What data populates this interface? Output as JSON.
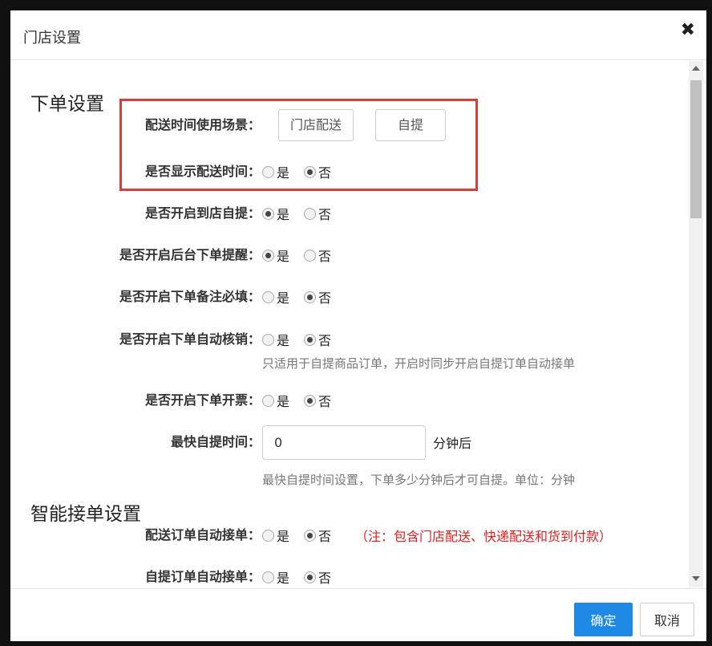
{
  "dialog": {
    "title": "门店设置",
    "close_icon": "close-icon"
  },
  "section_order": {
    "title": "下单设置",
    "delivery_scene": {
      "label": "配送时间使用场景：",
      "options": [
        "门店配送",
        "自提"
      ]
    },
    "show_delivery_time": {
      "label": "是否显示配送时间：",
      "yes": "是",
      "no": "否",
      "selected": "no"
    },
    "enable_store_pickup": {
      "label": "是否开启到店自提：",
      "yes": "是",
      "no": "否",
      "selected": "yes"
    },
    "enable_backend_alert": {
      "label": "是否开启后台下单提醒：",
      "yes": "是",
      "no": "否",
      "selected": "yes"
    },
    "require_remark": {
      "label": "是否开启下单备注必填：",
      "yes": "是",
      "no": "否",
      "selected": "no"
    },
    "auto_verify": {
      "label": "是否开启下单自动核销：",
      "yes": "是",
      "no": "否",
      "selected": "no",
      "hint": "只适用于自提商品订单，开启时同步开启自提订单自动接单"
    },
    "invoice": {
      "label": "是否开启下单开票：",
      "yes": "是",
      "no": "否",
      "selected": "no"
    },
    "earliest_pickup": {
      "label": "最快自提时间：",
      "value": "0",
      "unit": "分钟后",
      "hint": "最快自提时间设置，下单多少分钟后才可自提。单位：分钟"
    }
  },
  "section_auto_accept": {
    "title": "智能接单设置",
    "delivery_auto_accept": {
      "label": "配送订单自动接单：",
      "yes": "是",
      "no": "否",
      "selected": "no",
      "note": "（注：包含门店配送、快递配送和货到付款）"
    },
    "pickup_auto_accept": {
      "label": "自提订单自动接单：",
      "yes": "是",
      "no": "否",
      "selected": "no"
    }
  },
  "footer": {
    "confirm_label": "确定",
    "cancel_label": "取消"
  },
  "colors": {
    "highlight_border": "#dd3b3b",
    "primary_button": "#1e88e5",
    "note_red": "#e02020"
  }
}
